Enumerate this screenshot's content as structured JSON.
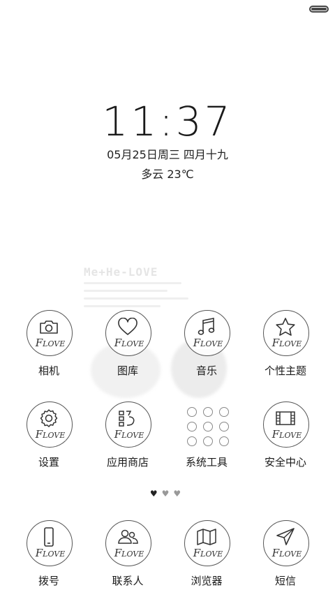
{
  "status_bar": {
    "battery_level": 1.0
  },
  "lock": {
    "time": "11:37",
    "date": "05月25日周三 四月十九",
    "weather": "多云  23℃"
  },
  "wallpaper": {
    "title": "Me+He-LOVE"
  },
  "brand": {
    "prefix": "F",
    "suffix": "LOVE"
  },
  "apps_row1": [
    {
      "label": "相机",
      "icon": "camera-icon"
    },
    {
      "label": "图库",
      "icon": "heart-icon"
    },
    {
      "label": "音乐",
      "icon": "music-note-icon"
    },
    {
      "label": "个性主题",
      "icon": "star-icon"
    }
  ],
  "apps_row2": [
    {
      "label": "设置",
      "icon": "gear-icon"
    },
    {
      "label": "应用商店",
      "icon": "app-store-icon"
    },
    {
      "label": "系统工具",
      "icon": "tools-folder-icon"
    },
    {
      "label": "安全中心",
      "icon": "film-icon"
    }
  ],
  "dock": [
    {
      "label": "拨号",
      "icon": "phone-icon"
    },
    {
      "label": "联系人",
      "icon": "contacts-icon"
    },
    {
      "label": "浏览器",
      "icon": "map-icon"
    },
    {
      "label": "短信",
      "icon": "send-icon"
    }
  ],
  "page_indicator": {
    "current": 1,
    "total": 3
  },
  "colors": {
    "ring": "#555555",
    "text": "#1a1a1a",
    "background": "#ffffff"
  }
}
